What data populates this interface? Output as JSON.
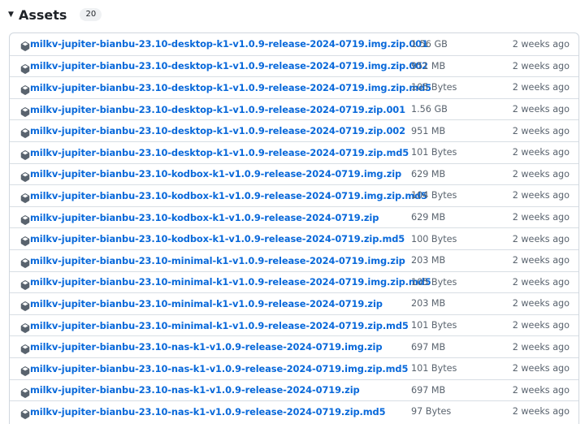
{
  "assets": {
    "title": "Assets",
    "count": "20",
    "rows": [
      {
        "name": "milkv-jupiter-bianbu-23.10-desktop-k1-v1.0.9-release-2024-0719.img.zip.001",
        "size": "1.56 GB",
        "date": "2 weeks ago"
      },
      {
        "name": "milkv-jupiter-bianbu-23.10-desktop-k1-v1.0.9-release-2024-0719.img.zip.002",
        "size": "951 MB",
        "date": "2 weeks ago"
      },
      {
        "name": "milkv-jupiter-bianbu-23.10-desktop-k1-v1.0.9-release-2024-0719.img.zip.md5",
        "size": "105 Bytes",
        "date": "2 weeks ago"
      },
      {
        "name": "milkv-jupiter-bianbu-23.10-desktop-k1-v1.0.9-release-2024-0719.zip.001",
        "size": "1.56 GB",
        "date": "2 weeks ago"
      },
      {
        "name": "milkv-jupiter-bianbu-23.10-desktop-k1-v1.0.9-release-2024-0719.zip.002",
        "size": "951 MB",
        "date": "2 weeks ago"
      },
      {
        "name": "milkv-jupiter-bianbu-23.10-desktop-k1-v1.0.9-release-2024-0719.zip.md5",
        "size": "101 Bytes",
        "date": "2 weeks ago"
      },
      {
        "name": "milkv-jupiter-bianbu-23.10-kodbox-k1-v1.0.9-release-2024-0719.img.zip",
        "size": "629 MB",
        "date": "2 weeks ago"
      },
      {
        "name": "milkv-jupiter-bianbu-23.10-kodbox-k1-v1.0.9-release-2024-0719.img.zip.md5",
        "size": "104 Bytes",
        "date": "2 weeks ago"
      },
      {
        "name": "milkv-jupiter-bianbu-23.10-kodbox-k1-v1.0.9-release-2024-0719.zip",
        "size": "629 MB",
        "date": "2 weeks ago"
      },
      {
        "name": "milkv-jupiter-bianbu-23.10-kodbox-k1-v1.0.9-release-2024-0719.zip.md5",
        "size": "100 Bytes",
        "date": "2 weeks ago"
      },
      {
        "name": "milkv-jupiter-bianbu-23.10-minimal-k1-v1.0.9-release-2024-0719.img.zip",
        "size": "203 MB",
        "date": "2 weeks ago"
      },
      {
        "name": "milkv-jupiter-bianbu-23.10-minimal-k1-v1.0.9-release-2024-0719.img.zip.md5",
        "size": "105 Bytes",
        "date": "2 weeks ago"
      },
      {
        "name": "milkv-jupiter-bianbu-23.10-minimal-k1-v1.0.9-release-2024-0719.zip",
        "size": "203 MB",
        "date": "2 weeks ago"
      },
      {
        "name": "milkv-jupiter-bianbu-23.10-minimal-k1-v1.0.9-release-2024-0719.zip.md5",
        "size": "101 Bytes",
        "date": "2 weeks ago"
      },
      {
        "name": "milkv-jupiter-bianbu-23.10-nas-k1-v1.0.9-release-2024-0719.img.zip",
        "size": "697 MB",
        "date": "2 weeks ago"
      },
      {
        "name": "milkv-jupiter-bianbu-23.10-nas-k1-v1.0.9-release-2024-0719.img.zip.md5",
        "size": "101 Bytes",
        "date": "2 weeks ago"
      },
      {
        "name": "milkv-jupiter-bianbu-23.10-nas-k1-v1.0.9-release-2024-0719.zip",
        "size": "697 MB",
        "date": "2 weeks ago"
      },
      {
        "name": "milkv-jupiter-bianbu-23.10-nas-k1-v1.0.9-release-2024-0719.zip.md5",
        "size": "97 Bytes",
        "date": "2 weeks ago"
      }
    ],
    "icon": "package-icon"
  },
  "colors": {
    "link": "#0969da",
    "muted": "#59636e",
    "border": "#d0d7de"
  }
}
